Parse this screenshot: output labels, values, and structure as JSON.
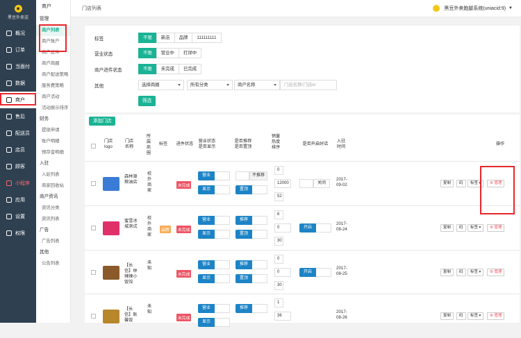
{
  "sidebar": {
    "brand": "黑豆外卖送",
    "items": [
      {
        "label": "概况",
        "icon": "overview-icon"
      },
      {
        "label": "订单",
        "icon": "order-icon"
      },
      {
        "label": "当面付",
        "icon": "payment-icon"
      },
      {
        "label": "数据",
        "icon": "data-icon"
      },
      {
        "label": "商户",
        "icon": "store-icon",
        "active": true
      },
      {
        "label": "售后",
        "icon": "aftersale-icon"
      },
      {
        "label": "配送员",
        "icon": "courier-icon"
      },
      {
        "label": "店员",
        "icon": "clerk-icon"
      },
      {
        "label": "顾客",
        "icon": "customer-icon"
      },
      {
        "label": "小程序",
        "icon": "miniprogram-icon",
        "red": true
      },
      {
        "label": "应用",
        "icon": "apps-icon"
      },
      {
        "label": "设置",
        "icon": "settings-icon"
      },
      {
        "label": "权限",
        "icon": "permission-icon"
      }
    ]
  },
  "subnav": {
    "title": "商户",
    "groups": [
      {
        "head": "管理",
        "items": [
          "商户列表",
          "商户账户",
          "商户进件",
          "商户商圈",
          "商户配送策略",
          "服务费策略",
          "商户活动",
          "活动展示排序"
        ]
      },
      {
        "head": "财务",
        "items": [
          "提现申请",
          "账户明细",
          "预存金明细"
        ]
      },
      {
        "head": "入驻",
        "items": [
          "入驻列表",
          "商家回收站"
        ]
      },
      {
        "head": "商户资讯",
        "items": [
          "资讯分类",
          "资讯列表"
        ]
      },
      {
        "head": "广告",
        "items": [
          "广告列表"
        ]
      },
      {
        "head": "其他",
        "items": [
          "公告列表"
        ]
      }
    ]
  },
  "topbar": {
    "title": "门店列表",
    "system": "黑豆外卖跑腿系统(uniacid:9)"
  },
  "filter": {
    "rows": [
      {
        "label": "标签",
        "options": [
          "不限",
          "新店",
          "品牌",
          "111111111"
        ]
      },
      {
        "label": "营业状态",
        "options": [
          "不限",
          "营业中",
          "打烊中"
        ]
      },
      {
        "label": "商户进件状态",
        "options": [
          "不限",
          "未完成",
          "已完成"
        ]
      }
    ],
    "other_label": "其他",
    "selects": [
      "选择商圈",
      "所有分类",
      "商户名称"
    ],
    "search_placeholder": "门店名称/门店id",
    "filter_button": "筛选"
  },
  "list": {
    "add_button": "添加门店",
    "headers": [
      "门店logo",
      "门店名称",
      "所属商圈",
      "标签",
      "进件状态",
      "营业状态 是否显示",
      "是否推荐 是否置顶",
      "销量 热度 排序",
      "是否开启好店",
      "入驻时间",
      "操作"
    ],
    "rows": [
      {
        "name": "森林源粮油店",
        "area": "校外商家",
        "tag": "",
        "status": "未完成",
        "open": "营业",
        "show": "显示",
        "recommend": "不推荐",
        "top": "置顶",
        "sales": "0",
        "heat": "12000",
        "sort": "52",
        "good": "关闭",
        "date": "2017-09-02"
      },
      {
        "name": "蜜雪冰城测试",
        "area": "校外商家",
        "tag": "品牌",
        "status": "未完成",
        "open": "营业",
        "show": "显示",
        "recommend": "推荐",
        "top": "置顶",
        "sales": "6",
        "heat": "0",
        "sort": "30",
        "good": "开启",
        "date": "2017-08-24"
      },
      {
        "name": "【长信】林辣辣小饭馆",
        "area": "未知",
        "tag": "",
        "status": "未完成",
        "open": "营业",
        "show": "显示",
        "recommend": "推荐",
        "top": "置顶",
        "sales": "0",
        "heat": "0",
        "sort": "30",
        "good": "开启",
        "date": "2017-08-25"
      },
      {
        "name": "【长信】耿馨饭",
        "area": "未知",
        "tag": "",
        "status": "未完成",
        "open": "营业",
        "show": "显示",
        "recommend": "推荐",
        "top": "",
        "sales": "1",
        "heat": "36",
        "sort": "",
        "good": "",
        "date": "2017-08-26"
      }
    ],
    "actions": [
      "复制",
      "码",
      "标签",
      "管理"
    ]
  }
}
